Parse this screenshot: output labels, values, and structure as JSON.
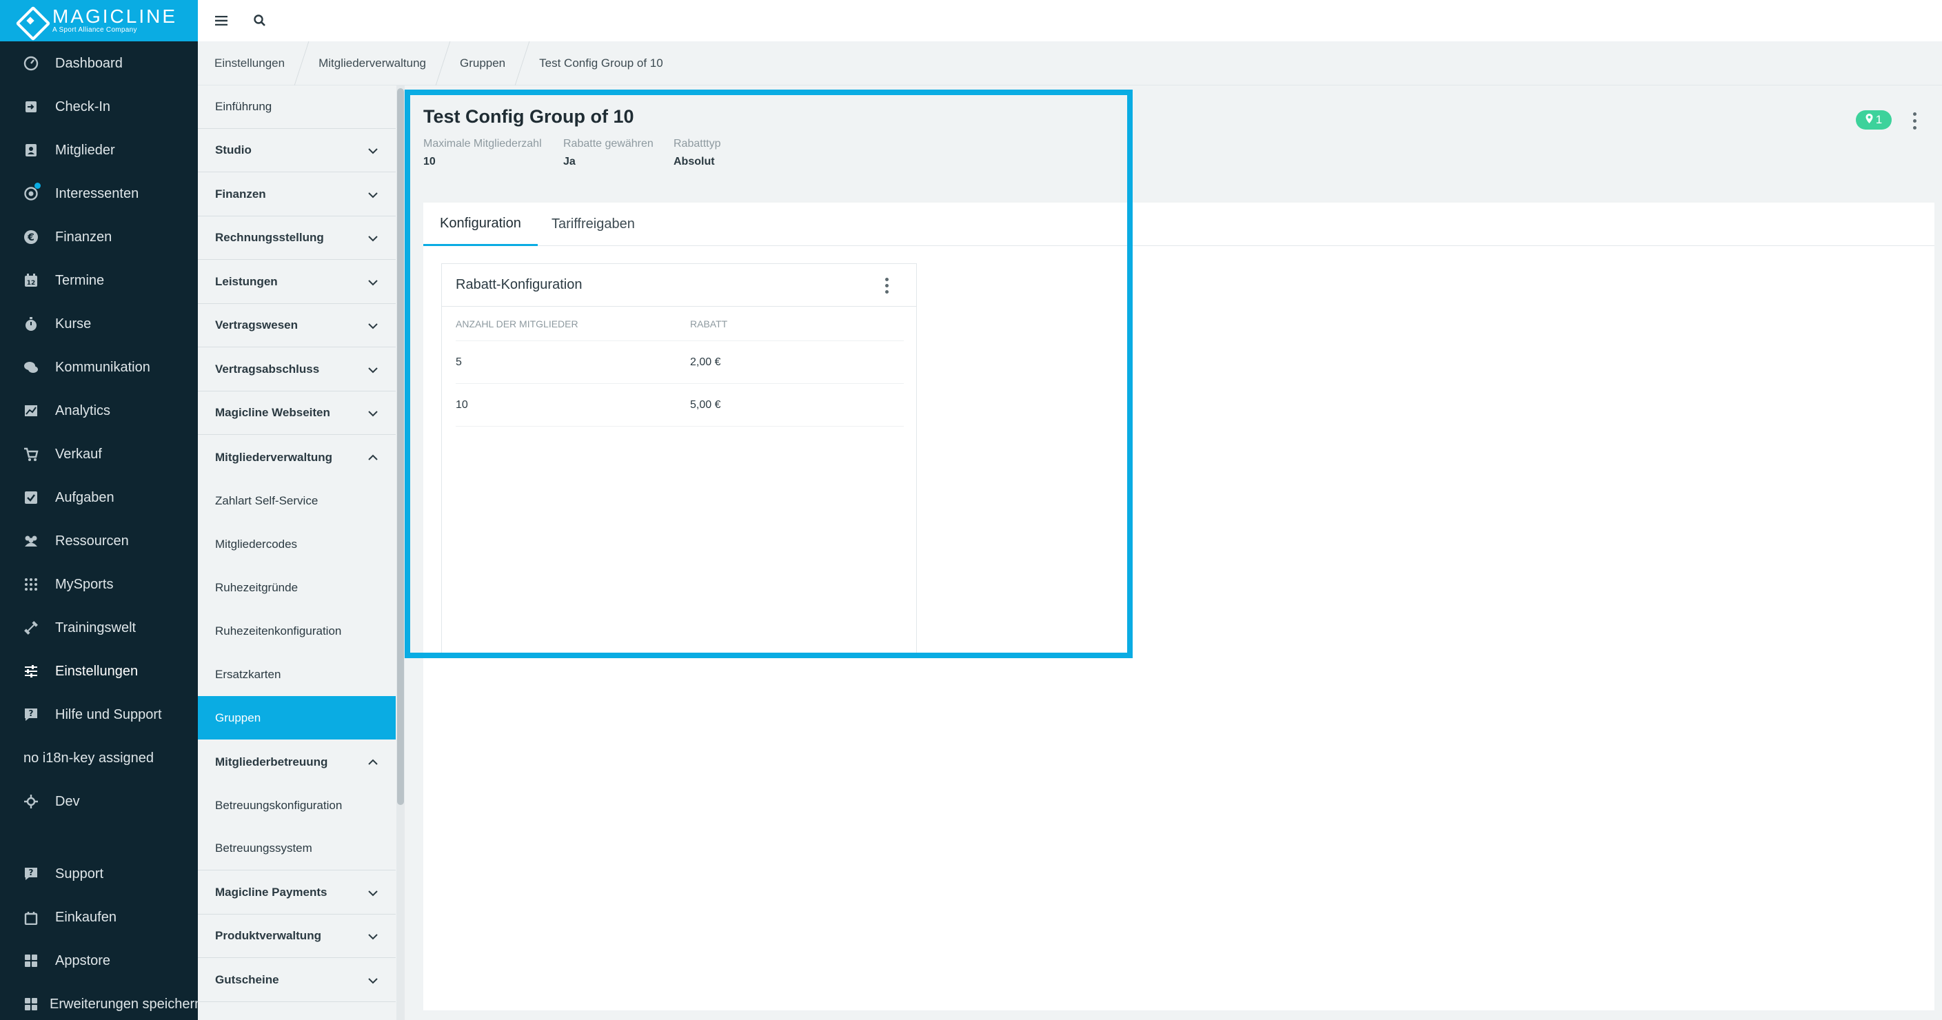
{
  "app": {
    "brand": "MAGICLINE",
    "brand_sub": "A Sport Alliance Company",
    "colors": {
      "accent": "#0aace3",
      "nav_bg": "#0e2530",
      "badge": "#3dd29b"
    }
  },
  "nav": {
    "items": [
      {
        "label": "Dashboard",
        "icon": "dashboard-icon"
      },
      {
        "label": "Check-In",
        "icon": "check-in-icon"
      },
      {
        "label": "Mitglieder",
        "icon": "members-icon"
      },
      {
        "label": "Interessenten",
        "icon": "prospects-icon"
      },
      {
        "label": "Finanzen",
        "icon": "euro-icon"
      },
      {
        "label": "Termine",
        "icon": "calendar-icon"
      },
      {
        "label": "Kurse",
        "icon": "stopwatch-icon"
      },
      {
        "label": "Kommunikation",
        "icon": "chat-icon"
      },
      {
        "label": "Analytics",
        "icon": "chart-icon"
      },
      {
        "label": "Verkauf",
        "icon": "cart-icon"
      },
      {
        "label": "Aufgaben",
        "icon": "checkbox-icon"
      },
      {
        "label": "Ressourcen",
        "icon": "people-icon"
      },
      {
        "label": "MySports",
        "icon": "grid-dots-icon"
      },
      {
        "label": "Trainingswelt",
        "icon": "dumbbell-icon"
      },
      {
        "label": "Einstellungen",
        "icon": "sliders-icon"
      },
      {
        "label": "Hilfe und Support",
        "icon": "help-icon"
      },
      {
        "label": "no i18n-key assigned",
        "icon": ""
      },
      {
        "label": "Dev",
        "icon": "crosshair-icon"
      },
      {
        "label": "Support",
        "icon": "support-icon"
      },
      {
        "label": "Einkaufen",
        "icon": "shopping-bag-icon"
      },
      {
        "label": "Appstore",
        "icon": "apps-icon"
      },
      {
        "label": "Erweiterungen speichern",
        "icon": "apps-icon"
      }
    ]
  },
  "breadcrumb": [
    "Einstellungen",
    "Mitgliederverwaltung",
    "Gruppen",
    "Test Config Group of 10"
  ],
  "submenu": {
    "intro": "Einführung",
    "items": [
      {
        "label": "Studio",
        "type": "group",
        "expanded": false
      },
      {
        "label": "Finanzen",
        "type": "group",
        "expanded": false
      },
      {
        "label": "Rechnungsstellung",
        "type": "group",
        "expanded": false
      },
      {
        "label": "Leistungen",
        "type": "group",
        "expanded": false
      },
      {
        "label": "Vertragswesen",
        "type": "group",
        "expanded": false
      },
      {
        "label": "Vertragsabschluss",
        "type": "group",
        "expanded": false
      },
      {
        "label": "Magicline Webseiten",
        "type": "group",
        "expanded": false
      },
      {
        "label": "Mitgliederverwaltung",
        "type": "group",
        "expanded": true
      },
      {
        "label": "Zahlart Self-Service",
        "type": "link"
      },
      {
        "label": "Mitgliedercodes",
        "type": "link"
      },
      {
        "label": "Ruhezeitgründe",
        "type": "link"
      },
      {
        "label": "Ruhezeitenkonfiguration",
        "type": "link"
      },
      {
        "label": "Ersatzkarten",
        "type": "link"
      },
      {
        "label": "Gruppen",
        "type": "link",
        "active": true
      },
      {
        "label": "Mitgliederbetreuung",
        "type": "group",
        "expanded": true
      },
      {
        "label": "Betreuungskonfiguration",
        "type": "link"
      },
      {
        "label": "Betreuungssystem",
        "type": "link"
      },
      {
        "label": "Magicline Payments",
        "type": "group",
        "expanded": false
      },
      {
        "label": "Produktverwaltung",
        "type": "group",
        "expanded": false
      },
      {
        "label": "Gutscheine",
        "type": "group",
        "expanded": false
      }
    ]
  },
  "detail": {
    "title": "Test Config Group of 10",
    "meta": [
      {
        "key": "Maximale Mitgliederzahl",
        "value": "10"
      },
      {
        "key": "Rabatte gewähren",
        "value": "Ja"
      },
      {
        "key": "Rabatttyp",
        "value": "Absolut"
      }
    ],
    "badge_count": "1",
    "tabs": [
      "Konfiguration",
      "Tariffreigaben"
    ],
    "active_tab": "Konfiguration",
    "card": {
      "title": "Rabatt-Konfiguration",
      "columns": [
        "ANZAHL DER MITGLIEDER",
        "RABATT"
      ],
      "rows": [
        [
          "5",
          "2,00 €"
        ],
        [
          "10",
          "5,00 €"
        ]
      ]
    }
  }
}
